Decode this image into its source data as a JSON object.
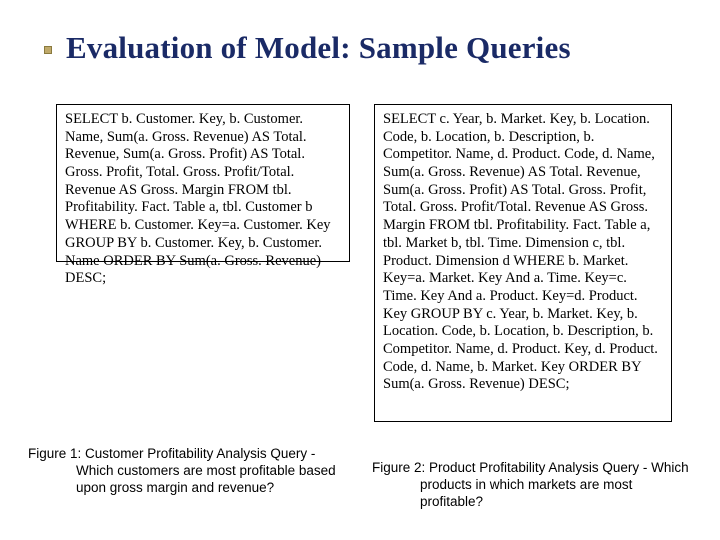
{
  "title_part1": "Evaluation of Model",
  "title_sep": ": ",
  "title_part2": "Sample Queries",
  "query_left": "SELECT b. Customer. Key, b. Customer. Name, Sum(a. Gross. Revenue) AS Total. Revenue, Sum(a. Gross. Profit) AS Total. Gross. Profit, Total. Gross. Profit/Total. Revenue AS Gross. Margin FROM tbl. Profitability. Fact. Table a, tbl. Customer b WHERE b. Customer. Key=a. Customer. Key GROUP BY b. Customer. Key, b. Customer. Name ORDER BY Sum(a. Gross. Revenue) DESC;",
  "query_right": "SELECT c. Year, b. Market. Key, b. Location. Code, b. Location, b. Description, b. Competitor. Name, d. Product. Code, d. Name, Sum(a. Gross. Revenue) AS Total. Revenue, Sum(a. Gross. Profit) AS Total. Gross. Profit, Total. Gross. Profit/Total. Revenue AS Gross. Margin FROM tbl. Profitability. Fact. Table a, tbl. Market b, tbl. Time. Dimension c, tbl. Product. Dimension d WHERE b. Market. Key=a. Market. Key And a. Time. Key=c. Time. Key And a. Product. Key=d. Product. Key GROUP BY c. Year, b. Market. Key, b. Location. Code, b. Location, b. Description, b. Competitor. Name, d. Product. Key, d. Product. Code, d. Name, b. Market. Key ORDER BY Sum(a. Gross. Revenue) DESC;",
  "caption_left_line1": "Figure 1: Customer Profitability Analysis Query -",
  "caption_left_line2": "Which customers are most profitable based",
  "caption_left_line3": "upon gross margin and revenue?",
  "caption_right_line1": "Figure 2: Product Profitability Analysis Query - Which",
  "caption_right_line2": "products in which markets are most",
  "caption_right_line3": "profitable?"
}
